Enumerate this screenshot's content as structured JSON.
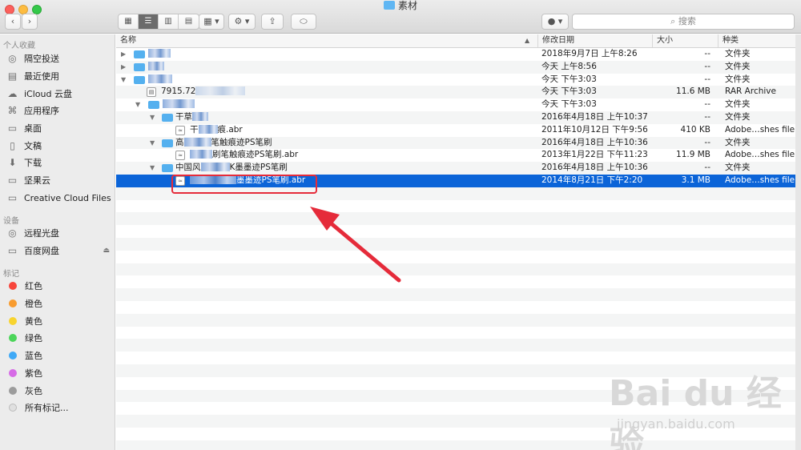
{
  "window": {
    "title": "素材"
  },
  "toolbar": {
    "search_placeholder": "搜索",
    "view_icon": "icon-grid",
    "view_list": "list",
    "view_columns": "columns",
    "view_cover": "cover-flow",
    "back_icon": "chevron-left-icon",
    "forward_icon": "chevron-right-icon"
  },
  "sidebar": {
    "favorites_header": "个人收藏",
    "favorites": [
      {
        "label": "隔空投送",
        "icon": "airdrop-icon"
      },
      {
        "label": "最近使用",
        "icon": "recents-icon"
      },
      {
        "label": "iCloud 云盘",
        "icon": "cloud-icon"
      },
      {
        "label": "应用程序",
        "icon": "applications-icon"
      },
      {
        "label": "桌面",
        "icon": "desktop-icon"
      },
      {
        "label": "文稿",
        "icon": "documents-icon"
      },
      {
        "label": "下载",
        "icon": "downloads-icon"
      },
      {
        "label": "坚果云",
        "icon": "folder-icon"
      },
      {
        "label": "Creative Cloud Files",
        "icon": "folder-icon"
      }
    ],
    "devices_header": "设备",
    "devices": [
      {
        "label": "远程光盘",
        "icon": "disc-icon"
      },
      {
        "label": "百度网盘",
        "icon": "drive-icon"
      }
    ],
    "tags_header": "标记",
    "tags": [
      {
        "label": "红色",
        "color": "#f7453b"
      },
      {
        "label": "橙色",
        "color": "#f89c30"
      },
      {
        "label": "黄色",
        "color": "#f8d42f"
      },
      {
        "label": "绿色",
        "color": "#4cd55a"
      },
      {
        "label": "蓝色",
        "color": "#3fa9f6"
      },
      {
        "label": "紫色",
        "color": "#d66be6"
      },
      {
        "label": "灰色",
        "color": "#9c9c9c"
      },
      {
        "label": "所有标记...",
        "color": "#e0e0e0"
      }
    ]
  },
  "columns": {
    "name": "名称",
    "date": "修改日期",
    "size": "大小",
    "kind": "种类"
  },
  "files": [
    {
      "name": "",
      "date": "2018年9月7日 上午8:26",
      "size": "--",
      "kind": "文件夹"
    },
    {
      "name": "",
      "date": "今天 上午8:56",
      "size": "--",
      "kind": "文件夹"
    },
    {
      "name": "",
      "date": "今天 下午3:03",
      "size": "--",
      "kind": "文件夹"
    },
    {
      "name": "7915.72",
      "date": "今天 下午3:03",
      "size": "11.6 MB",
      "kind": "RAR Archive"
    },
    {
      "name": "",
      "date": "今天 下午3:03",
      "size": "--",
      "kind": "文件夹"
    },
    {
      "name": "干草",
      "date": "2016年4月18日 上午10:37",
      "size": "--",
      "kind": "文件夹"
    },
    {
      "name": "干",
      "name2": "痕.abr",
      "date": "2011年10月12日 下午9:56",
      "size": "410 KB",
      "kind": "Adobe…shes file"
    },
    {
      "name": "高",
      "name2": "笔触痕迹PS笔刷",
      "date": "2016年4月18日 上午10:36",
      "size": "--",
      "kind": "文件夹"
    },
    {
      "name": "",
      "name2": "刷笔触痕迹PS笔刷.abr",
      "date": "2013年1月22日 下午11:23",
      "size": "11.9 MB",
      "kind": "Adobe…shes file"
    },
    {
      "name": "中国风",
      "name2": "K墨墨迹PS笔刷",
      "date": "2016年4月18日 上午10:36",
      "size": "--",
      "kind": "文件夹"
    },
    {
      "name": "",
      "name2": "墨墨迹PS笔刷.abr",
      "date": "2014年8月21日 下午2:20",
      "size": "3.1 MB",
      "kind": "Adobe…shes file"
    }
  ],
  "watermark": {
    "main": "Bai du 经验",
    "sub": "jingyan.baidu.com"
  },
  "annotation": {
    "color": "#e52b3a"
  }
}
